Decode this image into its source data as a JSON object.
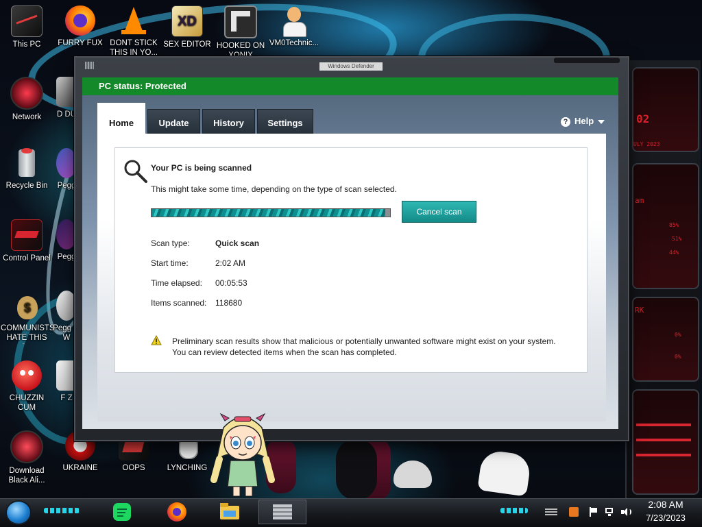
{
  "desktop": {
    "icons": [
      {
        "label": "This PC",
        "icon": "computer-icon"
      },
      {
        "label": "FURRY FUX",
        "icon": "firefox-icon"
      },
      {
        "label": "DONT STICK THIS IN YO...",
        "icon": "vlc-cone-icon"
      },
      {
        "label": "SEX EDITOR",
        "icon": "adobe-xd-icon"
      },
      {
        "label": "HOOKED ON XONIX",
        "icon": "xonix-game-icon"
      },
      {
        "label": "VM0Technic...",
        "icon": "doctor-avatar-icon"
      },
      {
        "label": "Network",
        "icon": "network-icon"
      },
      {
        "label": "D DU",
        "icon": "partial-icon"
      },
      {
        "label": "Recycle Bin",
        "icon": "recycle-bin-icon"
      },
      {
        "label": "Pegg",
        "icon": "partial-icon"
      },
      {
        "label": "Control Panel",
        "icon": "control-panel-icon"
      },
      {
        "label": "Pegg",
        "icon": "partial-icon"
      },
      {
        "label": "COMMUNISTS HATE THIS G...",
        "icon": "money-bag-icon"
      },
      {
        "label": "Pegg of W",
        "icon": "partial-icon"
      },
      {
        "label": "CHUZZIN CUM",
        "icon": "chuzzle-icon"
      },
      {
        "label": "F Z",
        "icon": "partial-icon"
      },
      {
        "label": "Download Black Ali...",
        "icon": "alienware-icon"
      },
      {
        "label": "UKRAINE",
        "icon": "ukraine-icon"
      },
      {
        "label": "OOPS",
        "icon": "oops-icon"
      },
      {
        "label": "LYNCHING",
        "icon": "lynching-icon"
      }
    ]
  },
  "window": {
    "title": "Windows Defender",
    "status": "PC status: Protected",
    "tabs": [
      {
        "label": "Home",
        "active": true
      },
      {
        "label": "Update",
        "active": false
      },
      {
        "label": "History",
        "active": false
      },
      {
        "label": "Settings",
        "active": false
      }
    ],
    "help_label": "Help",
    "scan": {
      "title": "Your PC is being scanned",
      "description": "This might take some time, depending on the type of scan selected.",
      "progress": 0.98,
      "cancel_label": "Cancel scan",
      "details": [
        {
          "label": "Scan type:",
          "value": "Quick scan",
          "bold": true
        },
        {
          "label": "Start time:",
          "value": "2:02 AM",
          "bold": false
        },
        {
          "label": "Time elapsed:",
          "value": "00:05:53",
          "bold": false
        },
        {
          "label": "Items scanned:",
          "value": "118680",
          "bold": false
        }
      ],
      "warning_line1": "Preliminary scan results show that malicious or potentially unwanted software might exist on your system.",
      "warning_line2": "You can review detected items when the scan has completed."
    },
    "colors": {
      "status_green": "#13892a",
      "accent_teal": "#1fa5a2"
    }
  },
  "side_panel": {
    "texts": [
      "02",
      "ULY 2023",
      "am",
      "85%",
      "51%",
      "44%",
      "RK",
      "0%",
      "0%"
    ]
  },
  "taskbar": {
    "apps": [
      "start-orb-icon",
      "spotify-icon",
      "firefox-icon",
      "file-explorer-icon",
      "windows-defender-icon"
    ],
    "tray_icons": [
      "flag-icon",
      "network-tray-icon",
      "volume-icon"
    ],
    "time": "2:08 AM",
    "date": "7/23/2023"
  }
}
